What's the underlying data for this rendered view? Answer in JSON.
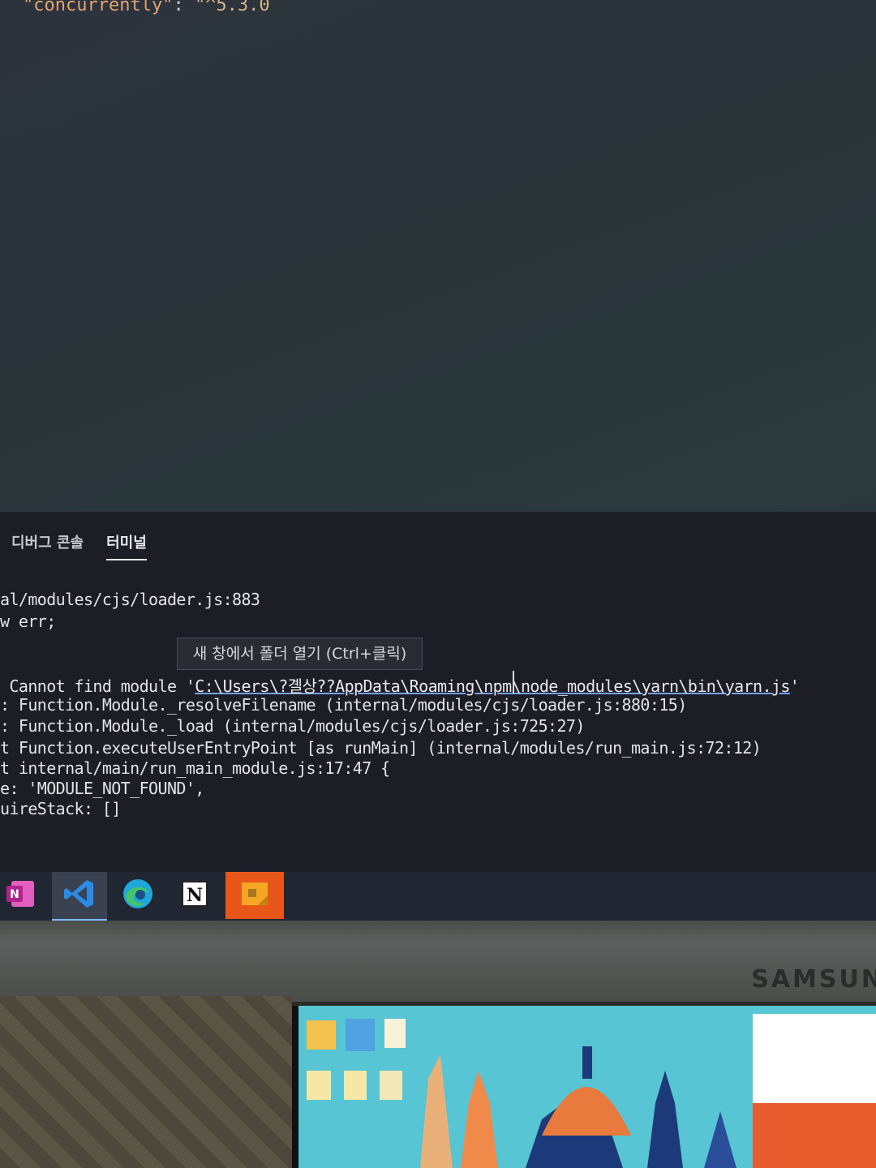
{
  "editor": {
    "code_key": "\"concurrently\"",
    "code_sep": ": ",
    "code_val": "\"^5.3.0"
  },
  "panel": {
    "tabs": [
      {
        "label": "디버그 콘솔",
        "active": false
      },
      {
        "label": "터미널",
        "active": true
      }
    ]
  },
  "terminal": {
    "lines": [
      "al/modules/cjs/loader.js:883",
      "w err;",
      "",
      "",
      ": Function.Module._resolveFilename (internal/modules/cjs/loader.js:880:15)",
      ": Function.Module._load (internal/modules/cjs/loader.js:725:27)",
      "t Function.executeUserEntryPoint [as runMain] (internal/modules/run_main.js:72:12)",
      "t internal/main/run_main_module.js:17:47 {",
      "e: 'MODULE_NOT_FOUND',",
      "uireStack: []"
    ],
    "error_prefix": " Cannot find module '",
    "error_path": "C:\\Users\\?곌상??AppData\\Roaming\\npm\\node_modules\\yarn\\bin\\yarn.js",
    "error_suffix": "'",
    "tooltip": "새 창에서 폴더 열기 (Ctrl+클릭)"
  },
  "taskbar": {
    "items": [
      {
        "name": "onenote-icon",
        "active": false,
        "color": "#c43e9b"
      },
      {
        "name": "vscode-icon",
        "active": true,
        "color": "#2a8ce6"
      },
      {
        "name": "edge-icon",
        "active": false,
        "color": "#1fa7d9"
      },
      {
        "name": "notion-icon",
        "active": false,
        "color": "#ffffff"
      },
      {
        "name": "sticky-notes-icon",
        "active": false,
        "color": "#f0a31a"
      }
    ]
  },
  "monitor": {
    "brand": "SAMSUN"
  }
}
